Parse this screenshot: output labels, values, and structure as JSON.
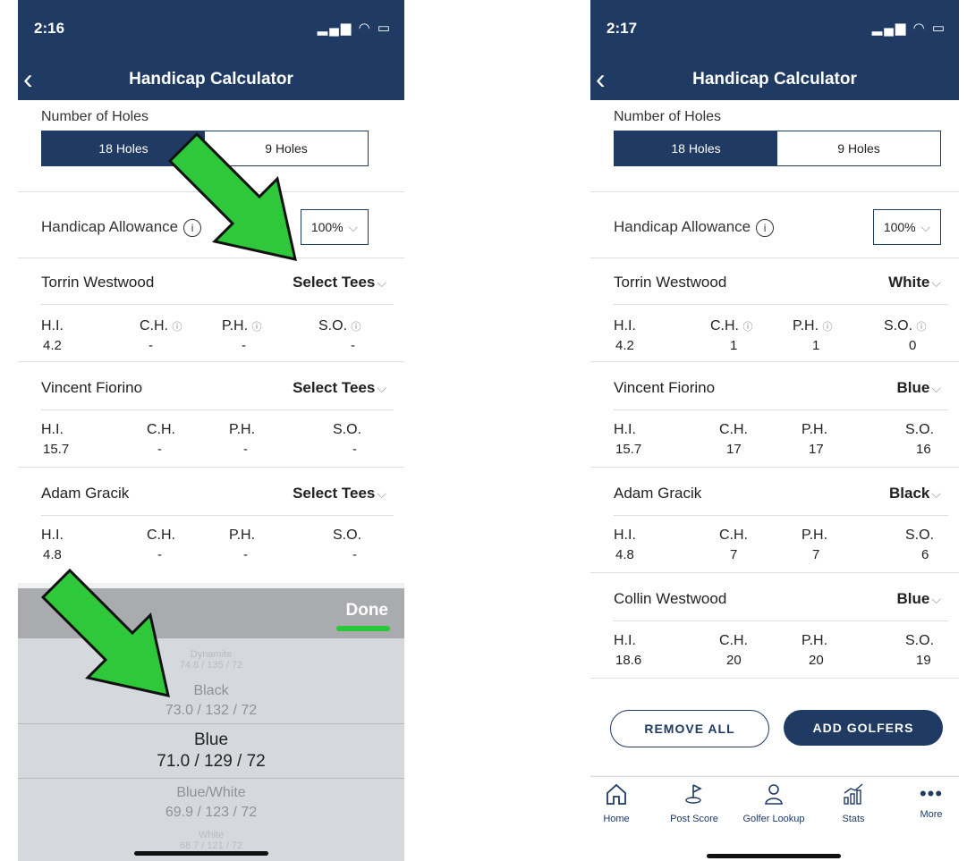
{
  "left": {
    "time": "2:16",
    "title": "Handicap Calculator",
    "holes_label": "Number of Holes",
    "holes_options": [
      "18 Holes",
      "9 Holes"
    ],
    "allowance_label": "Handicap Allowance",
    "allowance_value": "100%",
    "players": [
      {
        "name": "Torrin Westwood",
        "tees": "Select Tees",
        "hi": "4.2",
        "ch": "-",
        "ph": "-",
        "so": "-"
      },
      {
        "name": "Vincent Fiorino",
        "tees": "Select Tees",
        "hi": "15.7",
        "ch": "-",
        "ph": "-",
        "so": "-"
      },
      {
        "name": "Adam Gracik",
        "tees": "Select Tees",
        "hi": "4.8",
        "ch": "-",
        "ph": "-",
        "so": "-"
      }
    ],
    "headers": {
      "hi": "H.I.",
      "ch": "C.H.",
      "ph": "P.H.",
      "so": "S.O."
    },
    "done_label": "Done",
    "picker": [
      {
        "name": "Dynamite",
        "stats": "74.8 / 135 / 72"
      },
      {
        "name": "Black",
        "stats": "73.0 / 132 / 72"
      },
      {
        "name": "Blue",
        "stats": "71.0 / 129 / 72"
      },
      {
        "name": "Blue/White",
        "stats": "69.9 / 123 / 72"
      },
      {
        "name": "White",
        "stats": "68.7 / 121 / 72"
      }
    ]
  },
  "right": {
    "time": "2:17",
    "title": "Handicap Calculator",
    "holes_label": "Number of Holes",
    "holes_options": [
      "18 Holes",
      "9 Holes"
    ],
    "allowance_label": "Handicap Allowance",
    "allowance_value": "100%",
    "headers": {
      "hi": "H.I.",
      "ch": "C.H.",
      "ph": "P.H.",
      "so": "S.O."
    },
    "players": [
      {
        "name": "Torrin Westwood",
        "tees": "White",
        "hi": "4.2",
        "ch": "1",
        "ph": "1",
        "so": "0"
      },
      {
        "name": "Vincent Fiorino",
        "tees": "Blue",
        "hi": "15.7",
        "ch": "17",
        "ph": "17",
        "so": "16"
      },
      {
        "name": "Adam Gracik",
        "tees": "Black",
        "hi": "4.8",
        "ch": "7",
        "ph": "7",
        "so": "6"
      },
      {
        "name": "Collin Westwood",
        "tees": "Blue",
        "hi": "18.6",
        "ch": "20",
        "ph": "20",
        "so": "19"
      }
    ],
    "remove_all": "REMOVE ALL",
    "add_golfers": "ADD GOLFERS",
    "tabs": [
      "Home",
      "Post Score",
      "Golfer Lookup",
      "Stats",
      "More"
    ]
  },
  "colors": {
    "navy": "#1f3a63",
    "arrow": "#2ec83a",
    "picker_bg": "#d5d8dc"
  },
  "icons": [
    "back-icon",
    "info-icon",
    "chevron-down-icon",
    "home-icon",
    "post-score-icon",
    "golfer-lookup-icon",
    "stats-icon",
    "more-icon",
    "arrow-annotation"
  ]
}
